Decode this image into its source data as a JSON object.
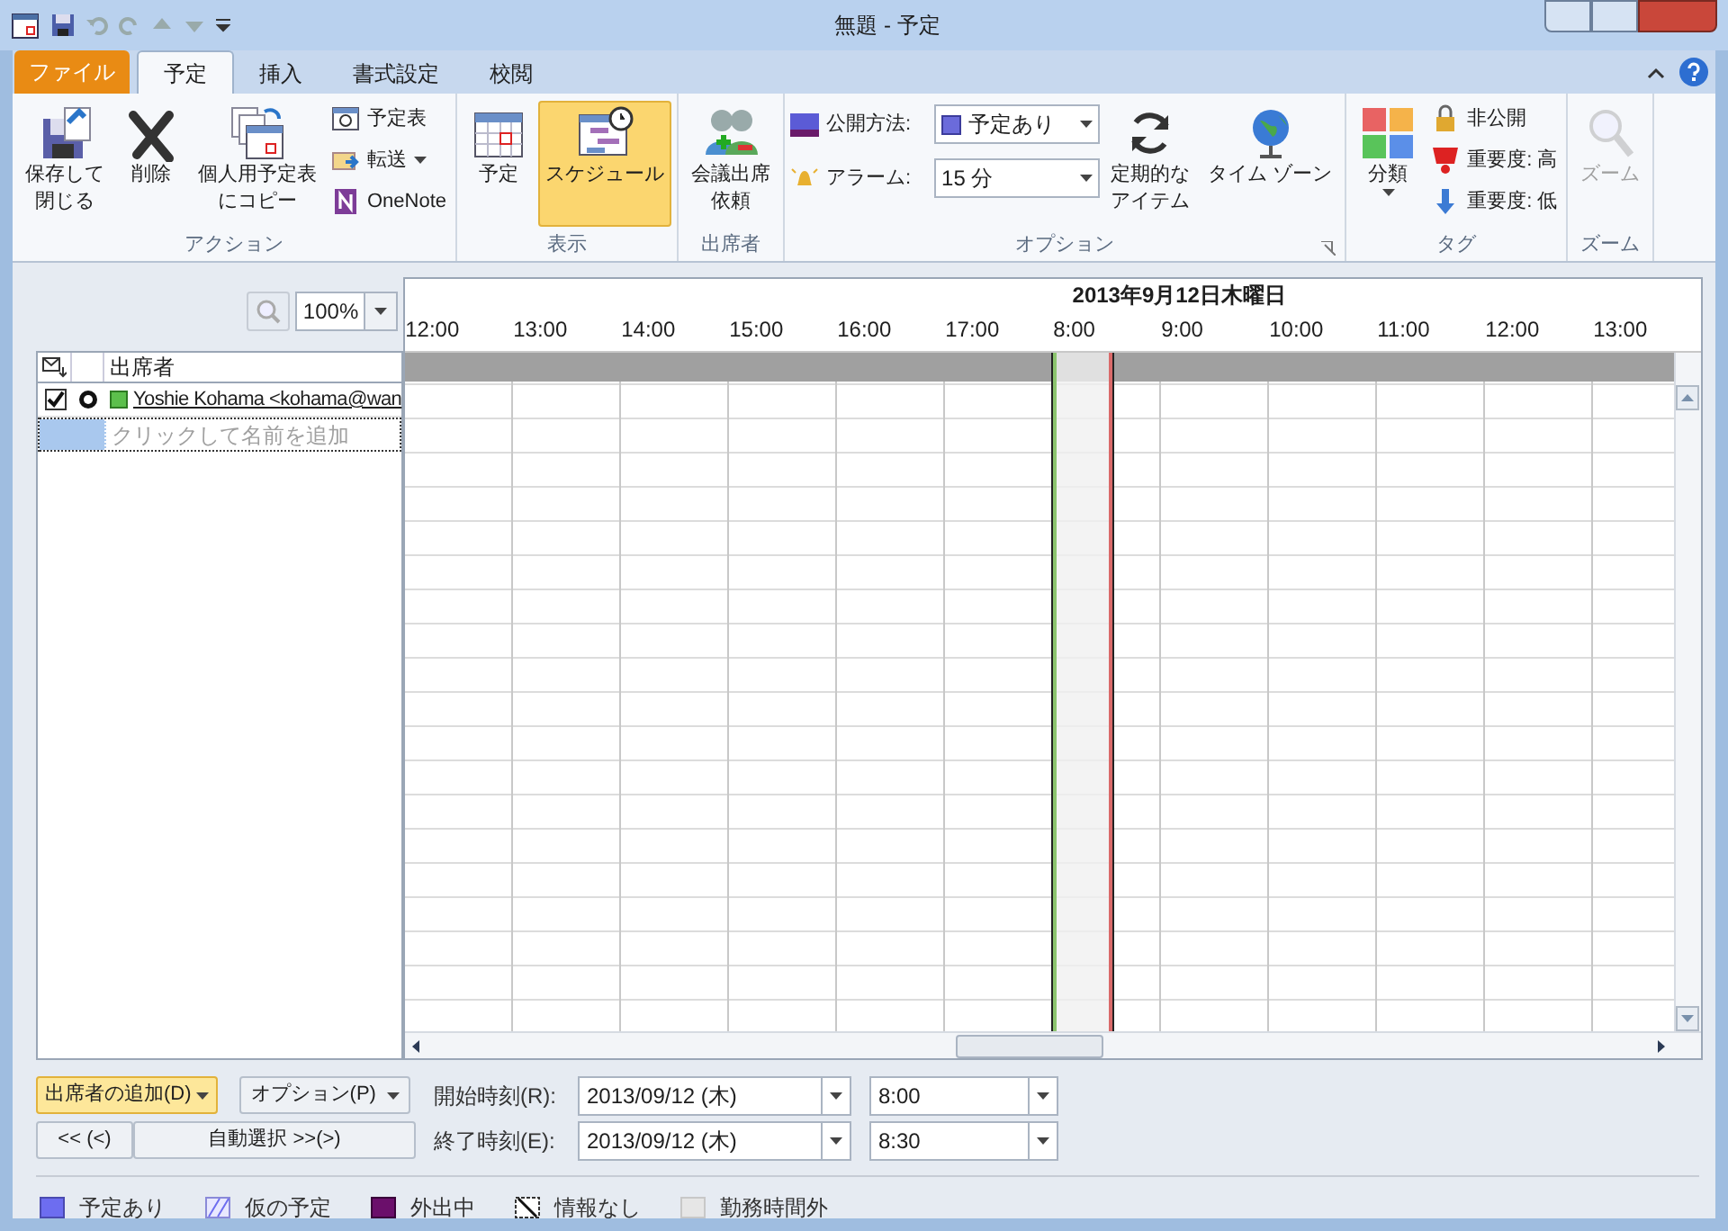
{
  "window": {
    "title": "無題 - 予定"
  },
  "tabs": [
    {
      "label": "ファイル",
      "kind": "file",
      "selected": false
    },
    {
      "label": "予定",
      "kind": "tab",
      "selected": true
    },
    {
      "label": "挿入",
      "kind": "tab",
      "selected": false
    },
    {
      "label": "書式設定",
      "kind": "tab",
      "selected": false
    },
    {
      "label": "校閲",
      "kind": "tab",
      "selected": false
    }
  ],
  "ribbon": {
    "groups": [
      {
        "label": "アクション",
        "items": [
          {
            "kind": "large",
            "label": "保存して閉じる",
            "selected": false
          },
          {
            "kind": "large",
            "label": "削除",
            "selected": false
          },
          {
            "kind": "large",
            "label": "個人用予定表にコピー",
            "selected": false
          },
          {
            "kind": "stack",
            "items": [
              {
                "label": "予定表",
                "dropdown": false
              },
              {
                "label": "転送",
                "dropdown": true
              },
              {
                "label": "OneNote",
                "dropdown": false
              }
            ]
          }
        ]
      },
      {
        "label": "表示",
        "items": [
          {
            "kind": "large",
            "label": "予定",
            "selected": false
          },
          {
            "kind": "large",
            "label": "スケジュール",
            "selected": true
          }
        ]
      },
      {
        "label": "出席者",
        "items": [
          {
            "kind": "large",
            "label": "会議出席依頼",
            "selected": false
          }
        ]
      },
      {
        "label": "オプション",
        "launcher": true,
        "items": [
          {
            "kind": "fields",
            "fields": [
              {
                "label": "公開方法:",
                "value": "予定あり"
              },
              {
                "label": "アラーム:",
                "value": "15 分"
              }
            ]
          },
          {
            "kind": "large",
            "label": "定期的なアイテム",
            "selected": false
          },
          {
            "kind": "large",
            "label": "タイム ゾーン",
            "selected": false
          }
        ]
      },
      {
        "label": "タグ",
        "items": [
          {
            "kind": "large",
            "label": "分類",
            "selected": false,
            "dropdown": true
          },
          {
            "kind": "stack",
            "items": [
              {
                "label": "非公開",
                "dropdown": false
              },
              {
                "label": "重要度: 高",
                "dropdown": false
              },
              {
                "label": "重要度: 低",
                "dropdown": false
              }
            ]
          }
        ]
      },
      {
        "label": "ズーム",
        "items": [
          {
            "kind": "large",
            "label": "ズーム",
            "selected": false,
            "disabled": true
          }
        ]
      }
    ]
  },
  "zoom_field": {
    "value": "100%"
  },
  "attendees": {
    "header": "出席者",
    "rows": [
      {
        "name": "Yoshie Kohama <kohama@wan",
        "checked": true
      }
    ],
    "placeholder": "クリックして名前を追加"
  },
  "timeline": {
    "date": "2013年9月12日木曜日",
    "hours": [
      {
        "label": "12:00",
        "selected": false
      },
      {
        "label": "13:00",
        "selected": false
      },
      {
        "label": "14:00",
        "selected": false
      },
      {
        "label": "15:00",
        "selected": false
      },
      {
        "label": "16:00",
        "selected": false
      },
      {
        "label": "17:00",
        "selected": false
      },
      {
        "label": "8:00",
        "selected": true
      },
      {
        "label": "9:00",
        "selected": false
      },
      {
        "label": "10:00",
        "selected": false
      },
      {
        "label": "11:00",
        "selected": false
      },
      {
        "label": "12:00",
        "selected": false
      },
      {
        "label": "13:00",
        "selected": false
      }
    ]
  },
  "buttons": {
    "add_attendee": {
      "label": "出席者の追加(D)",
      "hover": true
    },
    "options": {
      "label": "オプション(P)"
    },
    "previous": {
      "label": "<< (<)"
    },
    "auto_pick": {
      "label": "自動選択 >>(>)"
    }
  },
  "times": [
    {
      "label": "開始時刻(R):",
      "date": "2013/09/12 (木)",
      "time": "8:00"
    },
    {
      "label": "終了時刻(E):",
      "date": "2013/09/12 (木)",
      "time": "8:30"
    }
  ],
  "legend": [
    {
      "kind": "busy",
      "label": "予定あり"
    },
    {
      "kind": "tentative",
      "label": "仮の予定"
    },
    {
      "kind": "away",
      "label": "外出中"
    },
    {
      "kind": "noinfo",
      "label": "情報なし"
    },
    {
      "kind": "offhours",
      "label": "勤務時間外"
    }
  ]
}
